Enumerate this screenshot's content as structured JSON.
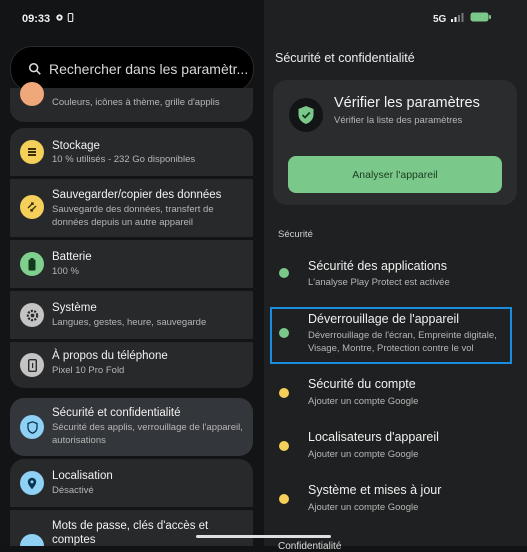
{
  "status": {
    "time": "09:33",
    "network": "5G"
  },
  "search": {
    "placeholder": "Rechercher dans les paramètr..."
  },
  "left_items": [
    {
      "title": "",
      "subtitle": "Couleurs, icônes à thème, grille d'applis",
      "icon": "palette-icon",
      "color": "#f0a77a"
    },
    {
      "title": "Stockage",
      "subtitle": "10 % utilisés - 232 Go disponibles",
      "icon": "storage-icon",
      "color": "#f4cf5a"
    },
    {
      "title": "Sauvegarder/copier des données",
      "subtitle": "Sauvegarde des données, transfert de données depuis un autre appareil",
      "icon": "transfer-icon",
      "color": "#f4cf5a"
    },
    {
      "title": "Batterie",
      "subtitle": "100 %",
      "icon": "battery-icon",
      "color": "#7fd08f"
    },
    {
      "title": "Système",
      "subtitle": "Langues, gestes, heure, sauvegarde",
      "icon": "gear-icon",
      "color": "#c4c4c4"
    },
    {
      "title": "À propos du téléphone",
      "subtitle": "Pixel 10 Pro Fold",
      "icon": "phone-icon",
      "color": "#c4c4c4"
    },
    {
      "title": "Sécurité et confidentialité",
      "subtitle": "Sécurité des applis, verrouillage de l'appareil, autorisations",
      "icon": "shield-icon",
      "color": "#8fd0f5"
    },
    {
      "title": "Localisation",
      "subtitle": "Désactivé",
      "icon": "location-icon",
      "color": "#8fd0f5"
    },
    {
      "title": "Mots de passe, clés d'accès et comptes",
      "subtitle": "",
      "icon": "key-icon",
      "color": "#8fd0f5"
    }
  ],
  "right": {
    "title": "Sécurité et confidentialité",
    "verify_title": "Vérifier les paramètres",
    "verify_sub": "Vérifier la liste des paramètres",
    "scan_button": "Analyser l'appareil",
    "section": "Sécurité",
    "items": [
      {
        "title": "Sécurité des applications",
        "subtitle": "L'analyse Play Protect est activée",
        "status": "ok"
      },
      {
        "title": "Déverrouillage de l'appareil",
        "subtitle": "Déverrouillage de l'écran, Empreinte digitale, Visage, Montre, Protection contre le vol",
        "status": "ok"
      },
      {
        "title": "Sécurité du compte",
        "subtitle": "Ajouter un compte Google",
        "status": "warn"
      },
      {
        "title": "Localisateurs d'appareil",
        "subtitle": "Ajouter un compte Google",
        "status": "warn"
      },
      {
        "title": "Système et mises à jour",
        "subtitle": "Ajouter un compte Google",
        "status": "warn"
      }
    ],
    "bottom_section": "Confidentialité"
  },
  "colors": {
    "ok": "#7bc98a",
    "warn": "#f4cf5a",
    "highlight": "#1b8de0"
  }
}
